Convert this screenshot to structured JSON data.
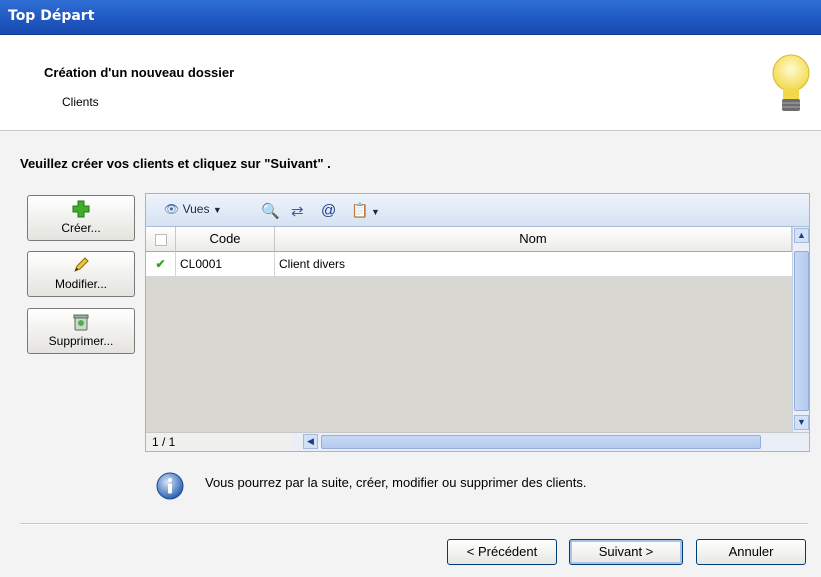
{
  "window": {
    "title": "Top Départ"
  },
  "header": {
    "title": "Création d'un nouveau dossier",
    "subtitle": "Clients",
    "icon": "lightbulb-icon"
  },
  "instruction": "Veuillez créer vos clients et cliquez sur \"Suivant\" .",
  "side_buttons": [
    {
      "label": "Créer...",
      "icon": "plus-icon"
    },
    {
      "label": "Modifier...",
      "icon": "pencil-icon"
    },
    {
      "label": "Supprimer...",
      "icon": "trash-icon"
    }
  ],
  "toolbar": {
    "views_label": "Vues",
    "icons": [
      "eye-icon",
      "preview-icon",
      "export-icon",
      "email-icon",
      "clipboard-icon"
    ]
  },
  "table": {
    "columns": [
      "Code",
      "Nom"
    ],
    "rows": [
      {
        "status": "check-icon",
        "code": "CL0001",
        "nom": "Client divers"
      }
    ]
  },
  "pager": "1 / 1",
  "info": {
    "text": "Vous pourrez par la suite, créer, modifier ou supprimer des clients.",
    "icon": "info-icon"
  },
  "nav": {
    "previous": "< Précédent",
    "next": "Suivant >",
    "cancel": "Annuler"
  },
  "colors": {
    "titlebar": "#2f6fd6",
    "grid_empty": "#d9d7d1",
    "check": "#3aa02a"
  }
}
